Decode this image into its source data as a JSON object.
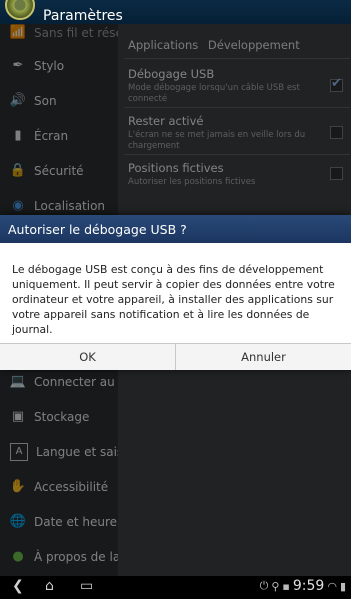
{
  "titlebar": {
    "title": "Paramètres"
  },
  "sidebar": {
    "items": [
      {
        "label": "Sans fil et rése",
        "icon": "wifi-icon"
      },
      {
        "label": "Stylo",
        "icon": "pen-icon"
      },
      {
        "label": "Son",
        "icon": "speaker-icon"
      },
      {
        "label": "Écran",
        "icon": "display-icon"
      },
      {
        "label": "Sécurité",
        "icon": "lock-icon"
      },
      {
        "label": "Localisation",
        "icon": "location-icon"
      },
      {
        "label": "Connecter au",
        "icon": "connect-pc-icon"
      },
      {
        "label": "Stockage",
        "icon": "storage-icon"
      },
      {
        "label": "Langue et sais",
        "icon": "language-icon"
      },
      {
        "label": "Accessibilité",
        "icon": "accessibility-icon"
      },
      {
        "label": "Date et heure",
        "icon": "globe-clock-icon"
      },
      {
        "label": "À propos de la",
        "icon": "info-icon"
      }
    ]
  },
  "panel": {
    "breadcrumb": [
      "Applications",
      "Développement"
    ],
    "options": [
      {
        "title": "Débogage USB",
        "subtitle": "Mode débogage lorsqu'un câble USB est connecté",
        "checked": true
      },
      {
        "title": "Rester activé",
        "subtitle": "L'écran ne se met jamais en veille lors du chargement",
        "checked": false
      },
      {
        "title": "Positions fictives",
        "subtitle": "Autoriser les positions fictives",
        "checked": false
      }
    ]
  },
  "dialog": {
    "title": "Autoriser le débogage USB ?",
    "body": "Le débogage USB est conçu à des fins de développement uniquement. Il peut servir à copier des données entre votre ordinateur et votre appareil, à installer des applications sur votre appareil sans notification et à lire les données de journal.",
    "ok_label": "OK",
    "cancel_label": "Annuler"
  },
  "navbar": {
    "back": "back-icon",
    "home": "home-icon",
    "recents": "recent-apps-icon",
    "clock": "9:59"
  },
  "colors": {
    "dialog_header": "#1b3560",
    "panel_bg": "#3b3e40",
    "check_accent": "#8fb8f0"
  }
}
